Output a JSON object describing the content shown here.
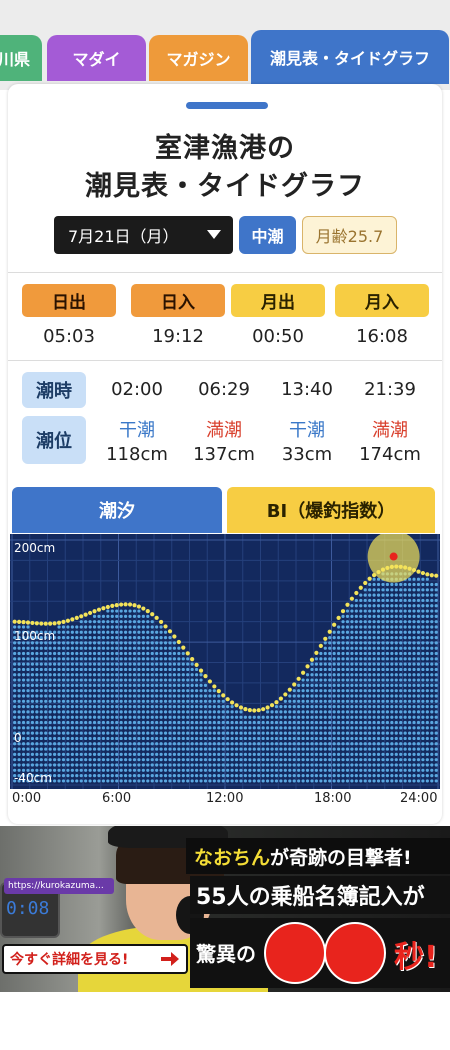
{
  "tabs": [
    {
      "label": "川県"
    },
    {
      "label": "マダイ"
    },
    {
      "label": "マガジン"
    },
    {
      "label": "潮見表・タイドグラフ"
    }
  ],
  "header": {
    "title_line_1": "室津漁港の",
    "title_line_2": "潮見表・タイドグラフ"
  },
  "controls": {
    "date": "7月21日（月）",
    "tide_type": "中潮",
    "moon_age": "月齢25.7"
  },
  "sun_moon": [
    {
      "label": "日出",
      "time": "05:03",
      "color": "#f09a3c"
    },
    {
      "label": "日入",
      "time": "19:12",
      "color": "#f09a3c"
    },
    {
      "label": "月出",
      "time": "00:50",
      "color": "#f7cd43"
    },
    {
      "label": "月入",
      "time": "16:08",
      "color": "#f7cd43"
    }
  ],
  "tides": {
    "time_label": "潮時",
    "level_label": "潮位",
    "events": [
      {
        "time": "02:00",
        "kind": "干潮",
        "height": "118cm"
      },
      {
        "time": "06:29",
        "kind": "満潮",
        "height": "137cm"
      },
      {
        "time": "13:40",
        "kind": "干潮",
        "height": "33cm"
      },
      {
        "time": "21:39",
        "kind": "満潮",
        "height": "174cm"
      }
    ]
  },
  "graph_tabs": {
    "tide": "潮汐",
    "bi": "BI（爆釣指数）"
  },
  "chart_data": {
    "type": "area",
    "x_unit": "hours",
    "xlim": [
      0,
      24
    ],
    "ylim": [
      -40,
      200
    ],
    "y_tick_labels": [
      "200cm",
      "100cm",
      "0",
      "-40cm"
    ],
    "y_ticks": [
      200,
      100,
      0,
      -40
    ],
    "x_tick_labels": [
      "0:00",
      "6:00",
      "12:00",
      "18:00",
      "24:00"
    ],
    "x_ticks": [
      0,
      6,
      12,
      18,
      24
    ],
    "x": [
      0,
      2,
      6.48,
      13.67,
      21.65,
      24
    ],
    "y": [
      120,
      118,
      137,
      33,
      174,
      165
    ],
    "current_time_marker": {
      "x": 21.5,
      "y": 174
    },
    "grid": true,
    "background": "#13295e",
    "fill_color": "#5aa7e0",
    "line_dot_color": "#f3e35a"
  },
  "ad": {
    "url": "https://kurokazuma...",
    "device_digits": "0:08",
    "headline_1_name": "なおちん",
    "headline_1_rest": "が奇跡の目撃者!",
    "headline_2": "55人の乗船名簿記入が",
    "headline_3_prefix": "驚異の",
    "headline_3_suffix": "秒!",
    "cta": "今すぐ詳細を見る!"
  }
}
